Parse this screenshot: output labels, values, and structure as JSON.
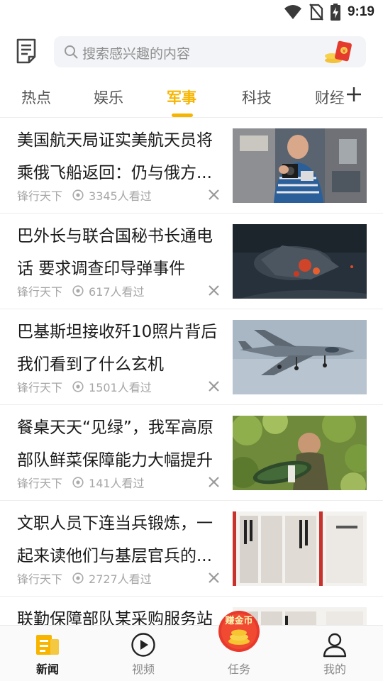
{
  "status_bar": {
    "time": "9:19",
    "icons": [
      "wifi-icon",
      "no-sim-icon",
      "battery-charging-icon"
    ]
  },
  "header": {
    "notes_icon": "notes-icon",
    "search_placeholder": "搜索感兴趣的内容",
    "redpacket_icon": "red-packet-icon"
  },
  "tabs": {
    "items": [
      {
        "label": "热点",
        "active": false
      },
      {
        "label": "娱乐",
        "active": false
      },
      {
        "label": "军事",
        "active": true
      },
      {
        "label": "科技",
        "active": false
      },
      {
        "label": "财经",
        "active": false
      }
    ],
    "add_icon": "plus-icon"
  },
  "feed": [
    {
      "title": "美国航天局证实美航天员将乘俄飞船返回：仍与俄方...",
      "source": "锋行天下",
      "views": "3345人看过",
      "image": "astronaut-photo"
    },
    {
      "title": "巴外长与联合国秘书长通电话 要求调查印导弹事件",
      "source": "锋行天下",
      "views": "617人看过",
      "image": "missile-crash-photo"
    },
    {
      "title": "巴基斯坦接收歼10照片背后我们看到了什么玄机",
      "source": "锋行天下",
      "views": "1501人看过",
      "image": "fighter-jet-photo"
    },
    {
      "title": "餐桌天天“见绿”，我军高原部队鲜菜保障能力大幅提升",
      "source": "锋行天下",
      "views": "141人看过",
      "image": "soldier-vegetable-photo"
    },
    {
      "title": "文职人员下连当兵锻炼，一起来读他们与基层官兵的...",
      "source": "锋行天下",
      "views": "2727人看过",
      "image": "newspaper-photo"
    },
    {
      "title": "联勤保障部队某采购服务站",
      "source": "",
      "views": "",
      "image": "newspaper-photo"
    }
  ],
  "bottom_nav": {
    "items": [
      {
        "label": "新闻",
        "icon": "news-icon",
        "active": true
      },
      {
        "label": "视频",
        "icon": "play-icon",
        "active": false
      },
      {
        "label": "任务",
        "icon": "coin-icon",
        "active": false
      },
      {
        "label": "我的",
        "icon": "user-icon",
        "active": false
      }
    ],
    "coin_badge": "赚金币"
  },
  "colors": {
    "accent": "#f8b500",
    "text": "#1a1a1a",
    "meta": "#a6a6a6",
    "coin_red": "#e8392c"
  }
}
